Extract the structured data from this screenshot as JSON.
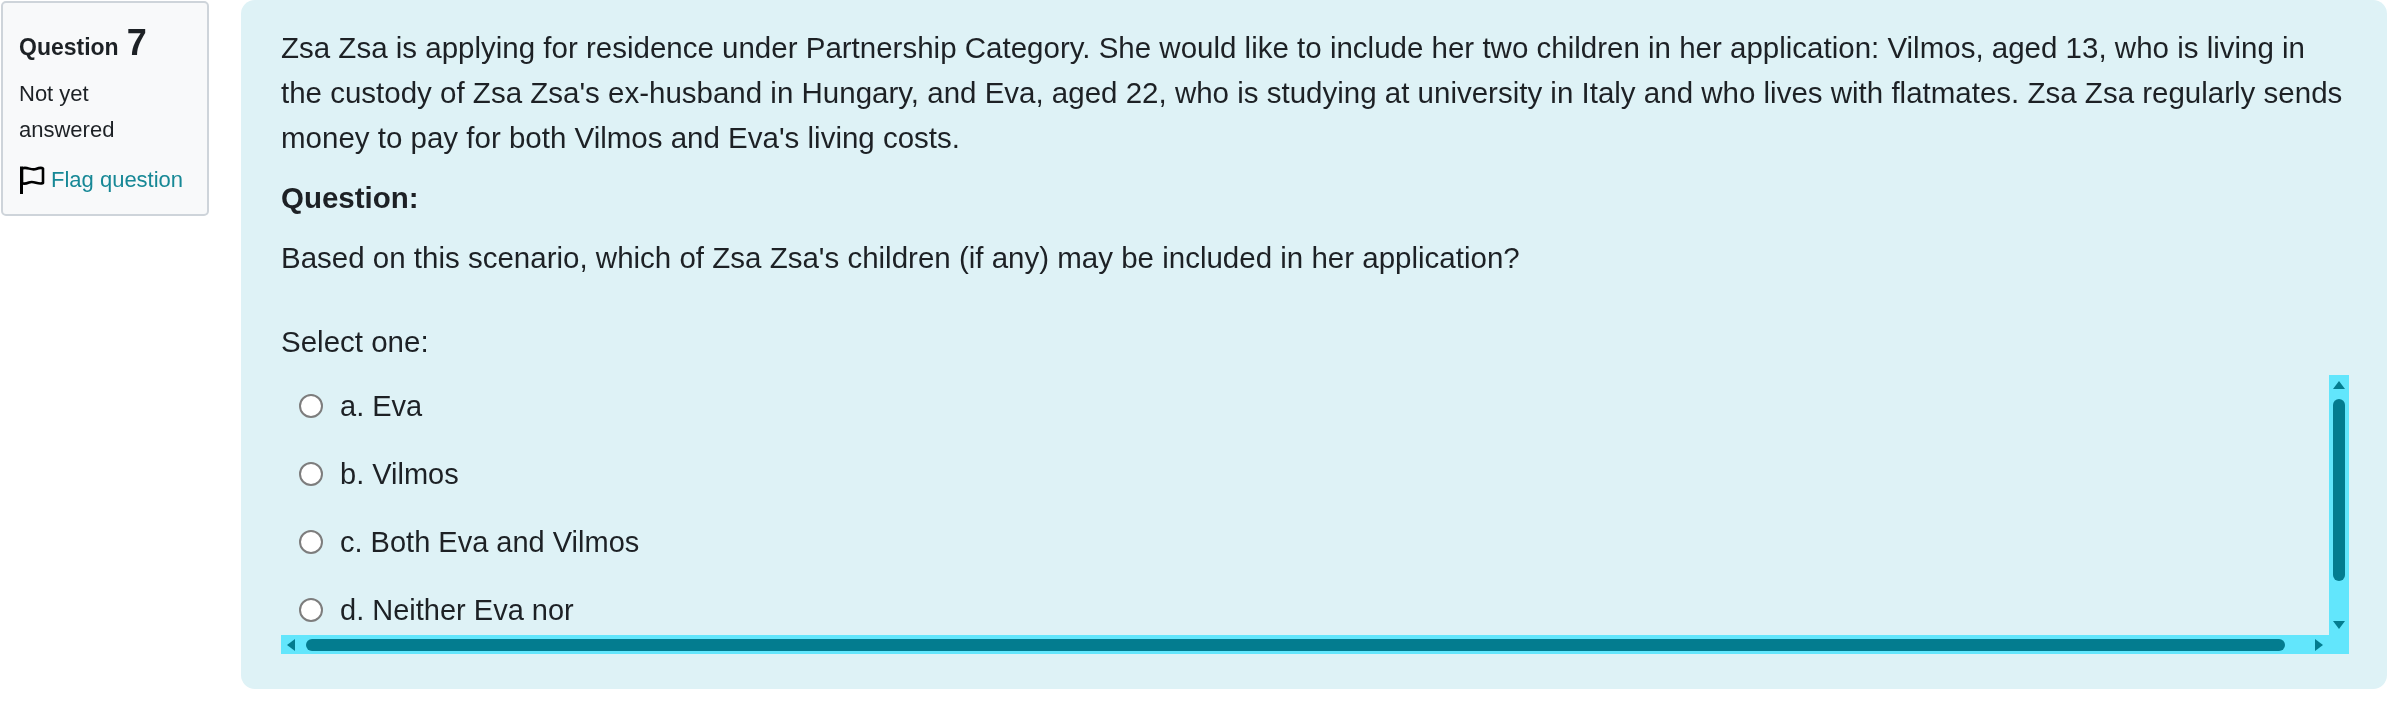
{
  "question_info": {
    "label": "Question",
    "number": "7",
    "status": "Not yet answered",
    "flag": {
      "label": "Flag question",
      "flagged": false
    }
  },
  "question": {
    "scenario": "Zsa Zsa is applying for residence under Partnership Category. She would like to include her two children in her application: Vilmos, aged 13, who is living in the custody of Zsa Zsa's ex-husband in Hungary, and Eva, aged 22, who is studying at university in Italy and who lives with flatmates. Zsa Zsa regularly sends money to pay for both Vilmos and Eva's living costs.",
    "heading": "Question:",
    "prompt": "Based on this scenario, which of Zsa Zsa's children (if any) may be included in her application?",
    "instruction": "Select one:",
    "options": [
      {
        "label": "a. Eva",
        "selected": false
      },
      {
        "label": "b. Vilmos",
        "selected": false
      },
      {
        "label": "c. Both Eva and Vilmos",
        "selected": false
      },
      {
        "label": "d. Neither Eva nor",
        "selected": false
      }
    ]
  }
}
